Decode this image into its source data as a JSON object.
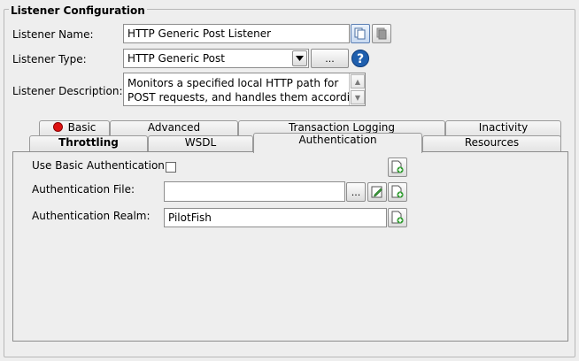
{
  "group": {
    "title": "Listener Configuration"
  },
  "fields": {
    "name_label": "Listener Name:",
    "name_value": "HTTP Generic Post Listener",
    "type_label": "Listener Type:",
    "type_value": "HTTP Generic Post",
    "type_browse": "...",
    "desc_label": "Listener Description:",
    "desc_lines": [
      "Monitors a specified local HTTP path for",
      "POST requests, and handles them according"
    ]
  },
  "tabs": {
    "row1": [
      "Basic",
      "Advanced",
      "Transaction Logging",
      "Inactivity"
    ],
    "row2": [
      "Throttling",
      "WSDL",
      "Authentication",
      "Resources"
    ],
    "selected": "Authentication",
    "basic_status_color": "#dd1111"
  },
  "auth": {
    "basic_label": "Use Basic Authentication:",
    "basic_checked": false,
    "file_label": "Authentication File:",
    "file_value": "",
    "file_browse": "...",
    "realm_label": "Authentication Realm:",
    "realm_value": "PilotFish"
  },
  "colors": {
    "accent": "#1a56a8",
    "help": "#1f5fae"
  }
}
